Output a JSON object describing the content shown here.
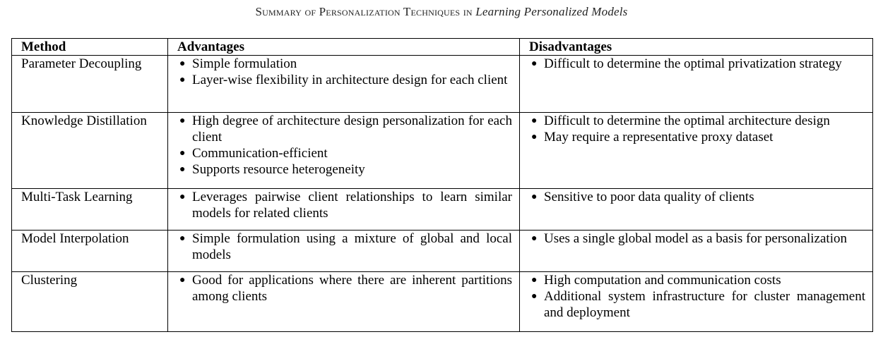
{
  "caption": {
    "plain": "Summary of Personalization Techniques in",
    "emphasis": "Learning Personalized Models"
  },
  "table": {
    "headers": [
      "Method",
      "Advantages",
      "Disadvantages"
    ],
    "rows": [
      {
        "method": "Parameter Decoupling",
        "advantages": [
          "Simple formulation",
          "Layer-wise flexibility in architecture design for each client"
        ],
        "disadvantages": [
          "Difficult to determine the optimal privatization strategy"
        ]
      },
      {
        "method": "Knowledge Distillation",
        "advantages": [
          "High degree of architecture design personalization for each client",
          "Communication-efficient",
          "Supports resource heterogeneity"
        ],
        "disadvantages": [
          "Difficult to determine the optimal architecture design",
          "May require a representative proxy dataset"
        ]
      },
      {
        "method": "Multi-Task Learning",
        "advantages": [
          "Leverages pairwise client relationships to learn similar models for related clients"
        ],
        "disadvantages": [
          "Sensitive to poor data quality of clients"
        ]
      },
      {
        "method": "Model Interpolation",
        "advantages": [
          "Simple formulation using a mixture of global and local models"
        ],
        "disadvantages": [
          "Uses a single global model as a basis for personalization"
        ]
      },
      {
        "method": "Clustering",
        "advantages": [
          "Good for applications where there are inherent partitions among clients"
        ],
        "disadvantages": [
          "High computation and communication costs",
          "Additional system infrastructure for cluster management and deployment"
        ]
      }
    ]
  }
}
